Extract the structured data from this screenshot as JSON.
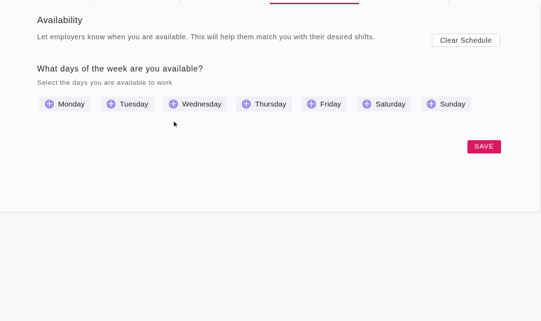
{
  "section": {
    "title": "Availability",
    "description": "Let employers know when you are available. This will help them match you with their desired shifts.",
    "clear_label": "Clear Schedule"
  },
  "days_section": {
    "question": "What days of the week are you available?",
    "subtext": "Select the days you are available to work",
    "days": [
      {
        "label": "Monday"
      },
      {
        "label": "Tuesday"
      },
      {
        "label": "Wednesday"
      },
      {
        "label": "Thursday"
      },
      {
        "label": "Friday"
      },
      {
        "label": "Saturday"
      },
      {
        "label": "Sunday"
      }
    ],
    "add_icon": "plus-icon"
  },
  "actions": {
    "save_label": "SAVE"
  },
  "colors": {
    "accent": "#d81b60",
    "chip_icon": "#9b93e6",
    "chip_background": "#f1f1f5"
  }
}
